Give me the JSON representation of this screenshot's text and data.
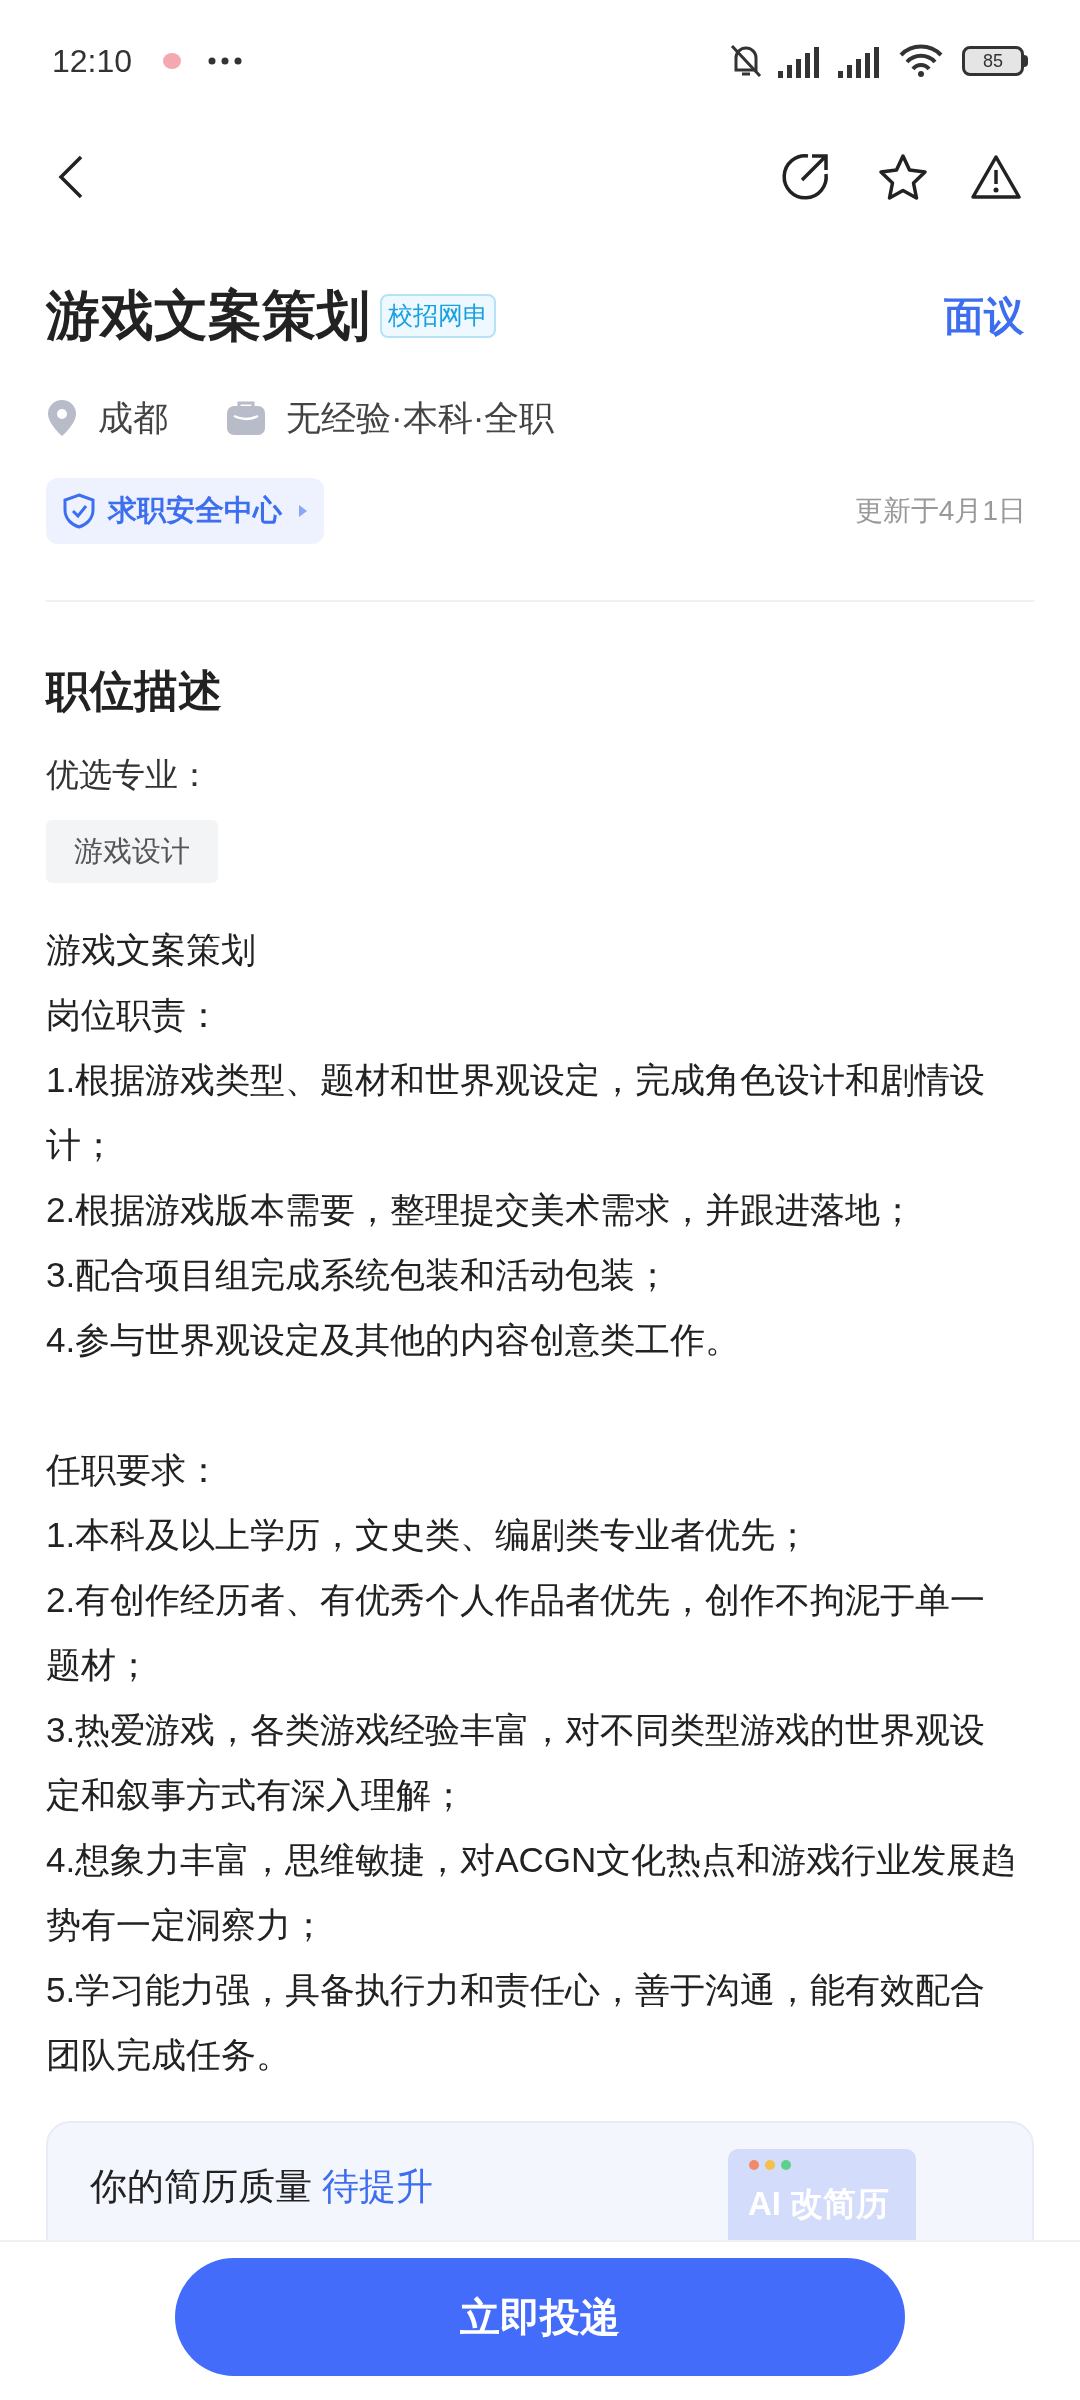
{
  "status_bar": {
    "time": "12:10",
    "battery": "85"
  },
  "job": {
    "title": "游戏文案策划",
    "tag": "校招网申",
    "salary": "面议",
    "location": "成都",
    "requirements": "无经验·本科·全职",
    "safety_link": "求职安全中心",
    "updated": "更新于4月1日"
  },
  "description": {
    "heading": "职位描述",
    "major_label": "优选专业：",
    "majors": [
      "游戏设计"
    ],
    "blocks": [
      [
        "游戏文案策划",
        "岗位职责：",
        "1.根据游戏类型、题材和世界观设定，完成角色设计和剧情设计；",
        "2.根据游戏版本需要，整理提交美术需求，并跟进落地；",
        "3.配合项目组完成系统包装和活动包装；",
        "4.参与世界观设定及其他的内容创意类工作。"
      ],
      [
        "任职要求：",
        "1.本科及以上学历，文史类、编剧类专业者优先；",
        "2.有创作经历者、有优秀个人作品者优先，创作不拘泥于单一题材；",
        "3.热爱游戏，各类游戏经验丰富，对不同类型游戏的世界观设定和叙事方式有深入理解；",
        "4.想象力丰富，思维敏捷，对ACGN文化热点和游戏行业发展趋势有一定洞察力；",
        "5.学习能力强，具备执行力和责任心，善于沟通，能有效配合团队完成任务。"
      ]
    ]
  },
  "resume_card": {
    "text": "你的简历质量 **待提升**",
    "badge": "AI 改简历"
  },
  "apply_button": "立即投递"
}
